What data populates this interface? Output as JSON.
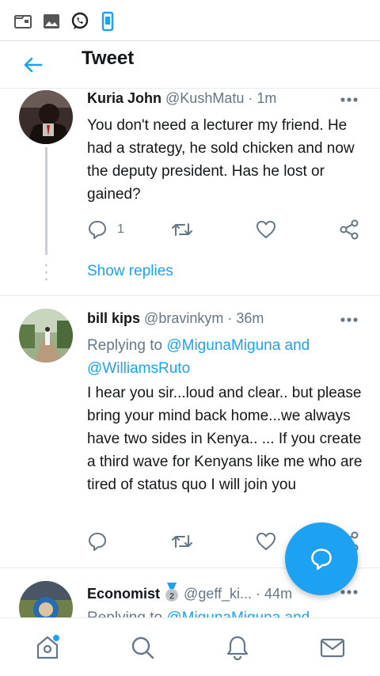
{
  "statusbar": {
    "icons": [
      "folder-icon",
      "image-icon",
      "whatsapp-icon",
      "phone-vibrate-icon"
    ]
  },
  "header": {
    "back_icon": "back-arrow-icon",
    "title": "Tweet"
  },
  "tweets": [
    {
      "name": "Kuria John",
      "handle": "@KushMatu",
      "time": "· 1m",
      "text": "You don't need a lecturer my friend. He had a strategy, he sold chicken and now the deputy president. Has he lost or gained?",
      "reply_count": "1",
      "show_replies": "Show replies"
    },
    {
      "name": "bill kips",
      "handle": "@bravinkym",
      "time": "· 36m",
      "replying_prefix": "Replying to",
      "mention1": "@MigunaMiguna",
      "and": "and",
      "mention2": "@WilliamsRuto",
      "text": "I hear you sir...loud and clear.. but please bring your mind back home...we always have two sides in Kenya.. ... If you create a third wave for Kenyans like me who are tired of status quo I will join you"
    },
    {
      "name": "Economist",
      "badge": "2",
      "handle": "@geff_ki...",
      "time": "· 44m",
      "replying_prefix": "Replying to",
      "mention1": "@MigunaMiguna",
      "and": "and"
    }
  ],
  "colors": {
    "accent": "#1da1f2",
    "text": "#14171a",
    "muted": "#657786"
  },
  "bottom_nav": [
    "home-icon",
    "search-icon",
    "notifications-bell-icon",
    "messages-envelope-icon"
  ]
}
